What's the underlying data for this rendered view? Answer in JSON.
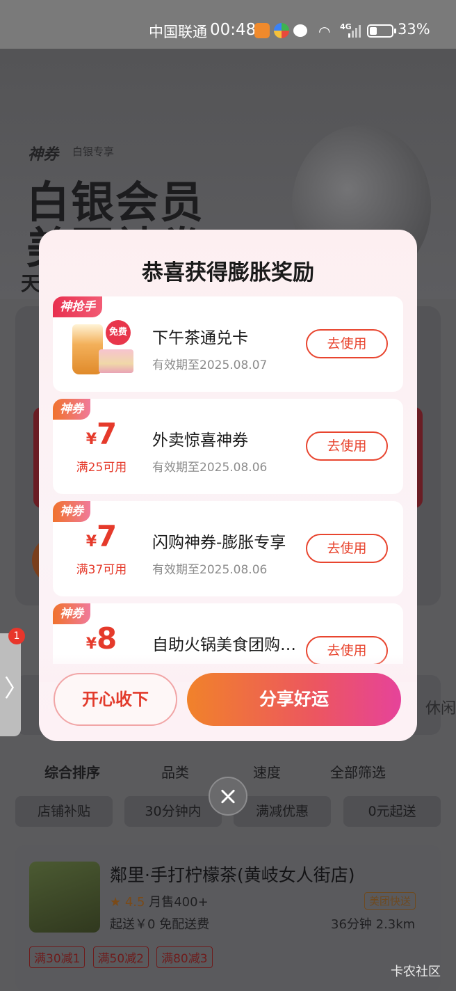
{
  "status_bar": {
    "carrier": "中国联通",
    "time": "00:48",
    "network": "4G",
    "battery": "33%",
    "battery_level": 0.33
  },
  "background": {
    "brand": "神券",
    "brand_sub": "白银专享",
    "hero_line1": "白银会员",
    "hero_line2": "美团神券",
    "hero_line3": "天",
    "strip_right": "休闲",
    "sort_tabs": [
      "综合排序",
      "品类",
      "速度",
      "全部筛选"
    ],
    "filter_chips": [
      "店铺补贴",
      "30分钟内",
      "满减优惠",
      "0元起送"
    ],
    "shop": {
      "name": "鄰里·手打柠檬茶(黄岐女人街店)",
      "rating": "4.5",
      "monthly_sales": "月售400+",
      "fast_badge": "美团快送",
      "fee": "起送￥0 免配送费",
      "eta": "36分钟 2.3km",
      "tags": [
        "满30减1",
        "满50减2",
        "满80减3"
      ]
    }
  },
  "side_tab": {
    "badge": "1"
  },
  "modal": {
    "title": "恭喜获得膨胀奖励",
    "rewards": [
      {
        "corner": "神抢手",
        "type": "image",
        "free_label": "免费",
        "name": "下午茶通兑卡",
        "valid": "有效期至2025.08.07",
        "button": "去使用"
      },
      {
        "corner": "神券",
        "type": "coupon",
        "currency": "¥",
        "amount": "7",
        "condition": "满25可用",
        "name": "外卖惊喜神券",
        "valid": "有效期至2025.08.06",
        "button": "去使用"
      },
      {
        "corner": "神券",
        "type": "coupon",
        "currency": "¥",
        "amount": "7",
        "condition": "满37可用",
        "name": "闪购神券-膨胀专享",
        "valid": "有效期至2025.08.06",
        "button": "去使用"
      },
      {
        "corner": "神券",
        "type": "coupon",
        "currency": "¥",
        "amount": "8",
        "condition": "",
        "name": "自助火锅美食团购神券",
        "valid": "",
        "button": "去使用"
      }
    ],
    "keep_button": "开心收下",
    "share_button": "分享好运"
  },
  "watermark": "卡农社区"
}
